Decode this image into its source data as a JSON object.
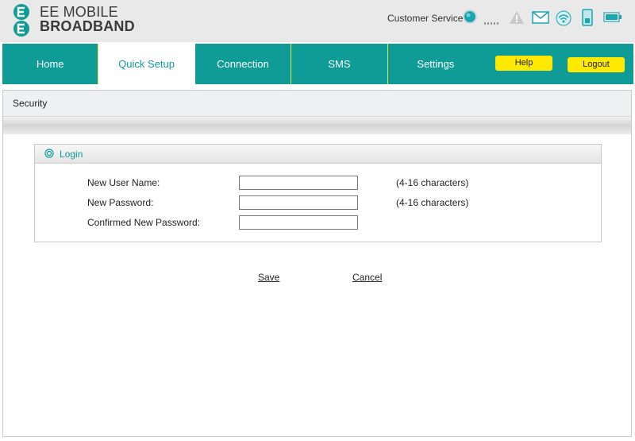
{
  "header": {
    "brand_line1": "EE MOBILE",
    "brand_line2": "BROADBAND",
    "customer_service": "Customer Service",
    "status_icons": [
      "connection-status-icon",
      "signal-strength-icon",
      "warning-icon",
      "message-icon",
      "wifi-icon",
      "sim-card-icon",
      "battery-icon"
    ]
  },
  "nav": {
    "tabs": [
      {
        "label": "Home"
      },
      {
        "label": "Quick Setup",
        "active": true
      },
      {
        "label": "Connection"
      },
      {
        "label": "SMS"
      },
      {
        "label": "Settings"
      }
    ],
    "help_label": "Help",
    "logout_label": "Logout"
  },
  "page": {
    "section_title": "Security",
    "panel_title": "Login",
    "fields": [
      {
        "label": "New User Name:",
        "value": "",
        "hint": "(4-16 characters)"
      },
      {
        "label": "New Password:",
        "value": "",
        "hint": "(4-16 characters)"
      },
      {
        "label": "Confirmed New Password:",
        "value": "",
        "hint": ""
      }
    ],
    "save_label": "Save",
    "cancel_label": "Cancel"
  },
  "colors": {
    "teal": "#0f9b96",
    "yellow": "#ffe900"
  }
}
